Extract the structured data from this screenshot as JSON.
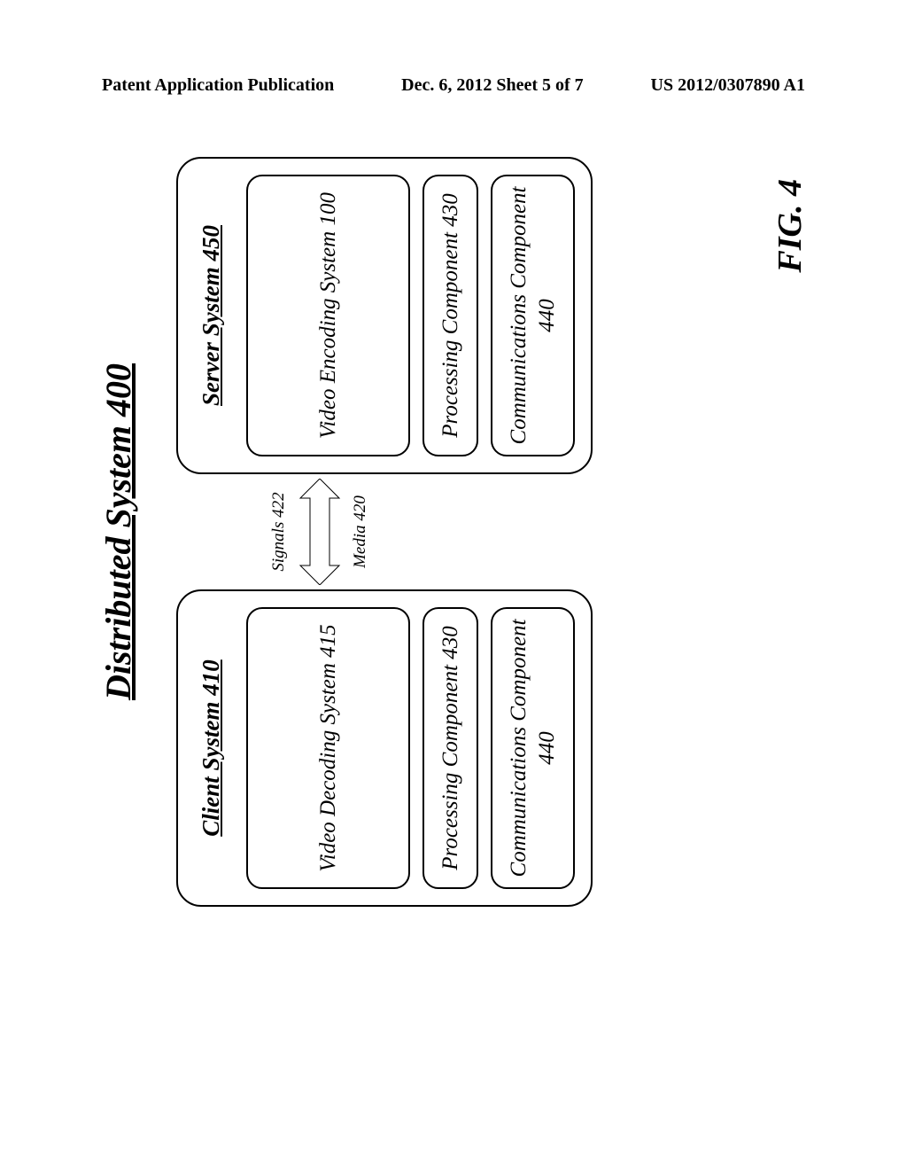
{
  "header": {
    "left": "Patent Application Publication",
    "center": "Dec. 6, 2012  Sheet 5 of 7",
    "right": "US 2012/0307890 A1"
  },
  "diagram": {
    "title": "Distributed System 400",
    "client": {
      "title": "Client System 410",
      "video": "Video Decoding System 415",
      "processing": "Processing Component 430",
      "comms": "Communications Component 440"
    },
    "server": {
      "title": "Server System 450",
      "video": "Video Encoding System 100",
      "processing": "Processing Component 430",
      "comms": "Communications Component 440"
    },
    "link": {
      "signals": "Signals 422",
      "media": "Media 420"
    }
  },
  "figure_caption": "FIG. 4"
}
